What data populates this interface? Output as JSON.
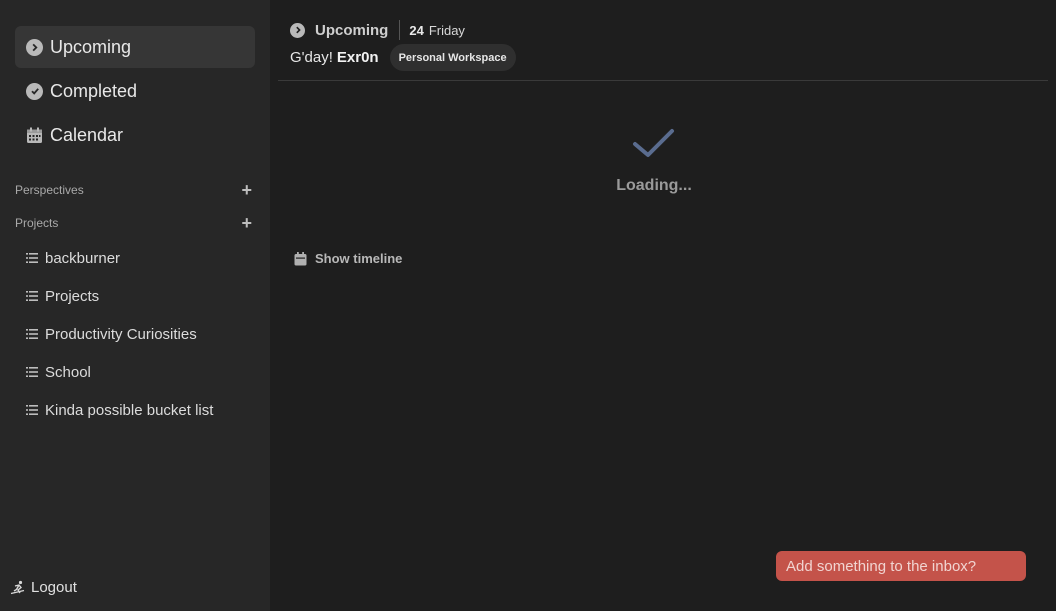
{
  "sidebar": {
    "nav": [
      {
        "label": "Upcoming",
        "icon": "chevron-right-circle-icon",
        "active": true
      },
      {
        "label": "Completed",
        "icon": "check-circle-icon",
        "active": false
      },
      {
        "label": "Calendar",
        "icon": "calendar-icon",
        "active": false
      }
    ],
    "perspectives_label": "Perspectives",
    "projects_label": "Projects",
    "projects": [
      {
        "label": "backburner"
      },
      {
        "label": "Projects"
      },
      {
        "label": "Productivity Curiosities"
      },
      {
        "label": "School"
      },
      {
        "label": "Kinda possible bucket list"
      }
    ],
    "logout_label": "Logout"
  },
  "header": {
    "title": "Upcoming",
    "date_num": "24",
    "date_day": "Friday",
    "greeting": "G'day!",
    "username": "Exr0n",
    "workspace": "Personal Workspace"
  },
  "main": {
    "loading_text": "Loading...",
    "show_timeline_label": "Show timeline"
  },
  "inbox": {
    "placeholder": "Add something to the inbox?"
  },
  "colors": {
    "sidebar_bg": "#272727",
    "main_bg": "#1e1e1e",
    "accent_inbox": "#c4534a",
    "check_blue": "#5a6c8f"
  }
}
